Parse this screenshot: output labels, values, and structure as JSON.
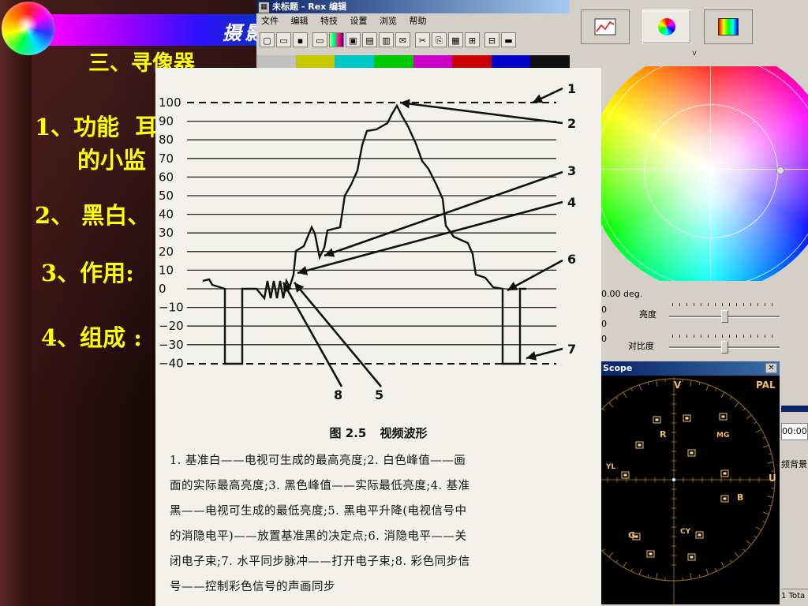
{
  "slide": {
    "title": "摄影",
    "section": "三、寻像器",
    "item1_prefix": "1、功能",
    "item1_trail": "耳",
    "item1_line2": "的小监",
    "item2": "2、 黑白、",
    "item3": "3、作用:",
    "item4": "4、组成 :"
  },
  "rex": {
    "window_title": "未标题 - Rex 编辑",
    "menu": [
      "文件",
      "编辑",
      "特技",
      "设置",
      "浏览",
      "帮助"
    ],
    "colorbars": [
      "#c0c0c0",
      "#c8c800",
      "#00c8c8",
      "#00c800",
      "#c800c8",
      "#c80000",
      "#0000c8",
      "#101010"
    ]
  },
  "panel": {
    "buttons": [
      "waveform-monitor",
      "vectorscope",
      "color-grid"
    ],
    "chevron": "v",
    "angle": "0.00 deg.",
    "brightness_label": "亮度",
    "contrast_label": "对比度",
    "left_values": [
      "0",
      "0",
      "0"
    ]
  },
  "scope": {
    "title": "Scope",
    "close": "✕",
    "standard": "PAL",
    "labels": {
      "v": "V",
      "u": "U",
      "r": "R",
      "mg": "MG",
      "yl": "YL",
      "b": "B",
      "g": "G",
      "cy": "CY"
    }
  },
  "right_strip": {
    "time": "00:00",
    "bg_label": "频背景",
    "total": "Tota",
    "total_prefix": "1"
  },
  "figure": {
    "y_ticks": [
      "100",
      "90",
      "80",
      "70",
      "60",
      "50",
      "40",
      "30",
      "20",
      "10",
      "0",
      "−10",
      "−20",
      "−30",
      "−40"
    ],
    "callouts": [
      "1",
      "2",
      "3",
      "4",
      "6",
      "7",
      "8",
      "5"
    ],
    "caption_number": "图 2.5",
    "caption_title": "视频波形",
    "notes": [
      "1. 基准白——电视可生成的最高亮度;2. 白色峰值——画",
      "面的实际最高亮度;3. 黑色峰值——实际最低亮度;4. 基准",
      "黑——电视可生成的最低亮度;5. 黑电平升降(电视信号中",
      "的消隐电平)——放置基准黑的决定点;6. 消隐电平——关",
      "闭电子束;7. 水平同步脉冲——打开电子束;8. 彩色同步信",
      "号——控制彩色信号的声画同步"
    ]
  }
}
